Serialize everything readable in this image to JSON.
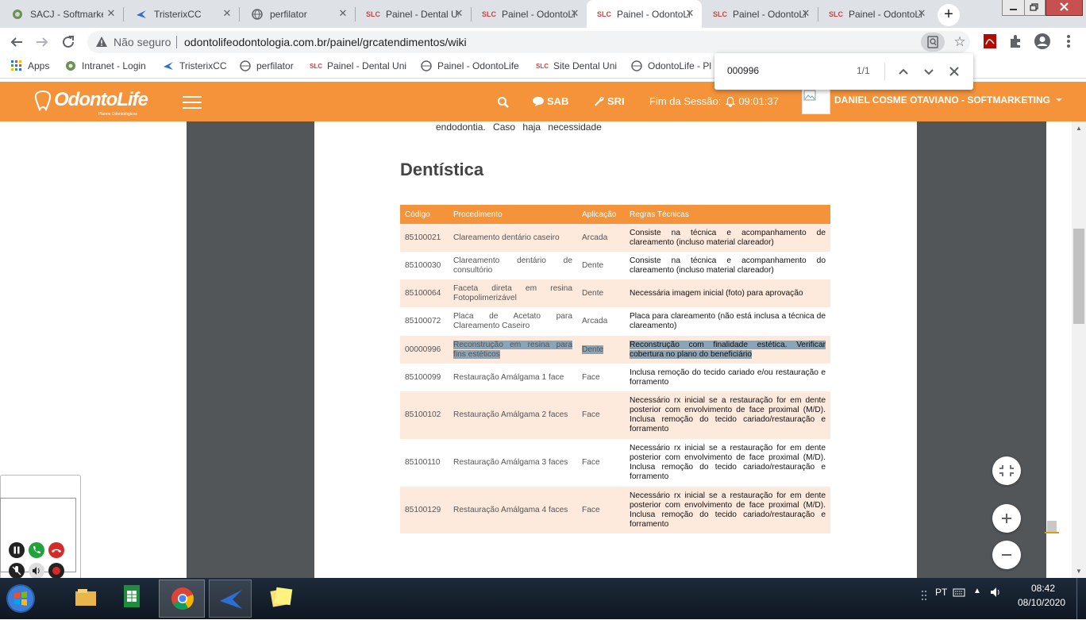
{
  "tabs": [
    {
      "label": "SACJ - Softmarketing",
      "icon": "globe-icon",
      "active": false
    },
    {
      "label": "TristerixCC",
      "icon": "tristerix-icon",
      "active": false
    },
    {
      "label": "perfilator",
      "icon": "globe-icon",
      "active": false
    },
    {
      "label": "Painel - Dental Uni",
      "icon": "slc-icon",
      "active": false
    },
    {
      "label": "Painel - OdontoLife",
      "icon": "slc-icon",
      "active": false
    },
    {
      "label": "Painel - OdontoLife",
      "icon": "slc-icon",
      "active": true
    },
    {
      "label": "Painel - OdontoLife",
      "icon": "slc-icon",
      "active": false
    },
    {
      "label": "Painel - OdontoLife",
      "icon": "slc-icon",
      "active": false
    }
  ],
  "toolbar": {
    "security_label": "Não seguro",
    "url": "odontolifeodontologia.com.br/painel/grcatendimentos/wiki"
  },
  "bookmarks": [
    {
      "label": "Apps",
      "icon": "apps-grid-icon"
    },
    {
      "label": "Intranet - Login",
      "icon": "globe-icon"
    },
    {
      "label": "TristerixCC",
      "icon": "tristerix-icon"
    },
    {
      "label": "perfilator",
      "icon": "globe-icon"
    },
    {
      "label": "Painel - Dental Uni",
      "icon": "slc-icon"
    },
    {
      "label": "Painel - OdontoLife",
      "icon": "globe-icon"
    },
    {
      "label": "Site Dental Uni",
      "icon": "slc-icon"
    },
    {
      "label": "OdontoLife - Pl",
      "icon": "globe-icon"
    }
  ],
  "findbar": {
    "query": "000996",
    "count": "1/1"
  },
  "header": {
    "logo": "OdontoLife",
    "logo_tagline": "Planos Odontológicos",
    "sab_label": "SAB",
    "sri_label": "SRI",
    "session_label": "Fim da Sessão:",
    "session_time": "09:01:37",
    "user_name": "DANIEL COSME OTAVIANO - SOFTMARKETING"
  },
  "document": {
    "top_cut_text": "endodontia. Caso haja necessidade",
    "section_title": "Dentística",
    "columns": [
      "Código",
      "Procedimento",
      "Aplicação",
      "Regras Técnicas"
    ],
    "rows": [
      {
        "codigo": "85100021",
        "procedimento": "Clareamento dentário caseiro",
        "aplicacao": "Arcada",
        "regras": "Consiste na técnica e acompanhamento de clareamento (incluso material clareador)"
      },
      {
        "codigo": "85100030",
        "procedimento": "Clareamento dentário de consultório",
        "aplicacao": "Dente",
        "regras": "Consiste na técnica e acompanhamento do clareamento (incluso material clareador)"
      },
      {
        "codigo": "85100064",
        "procedimento": "Faceta direta em resina Fotopolimerizável",
        "aplicacao": "Dente",
        "regras": "Necessária imagem inicial (foto) para aprovação"
      },
      {
        "codigo": "85100072",
        "procedimento": "Placa de Acetato para Clareamento Caseiro",
        "aplicacao": "Arcada",
        "regras": "Placa para clareamento (não está inclusa a técnica de clareamento)"
      },
      {
        "codigo": "00000996",
        "procedimento": "Reconstrução em resina para fins estéticos",
        "aplicacao": "Dente",
        "regras": "Reconstrução com finalidade estética. Verificar cobertura no plano do beneficiário",
        "highlight": true
      },
      {
        "codigo": "85100099",
        "procedimento": "Restauração Amálgama 1 face",
        "aplicacao": "Face",
        "regras": "Inclusa remoção do tecido cariado e/ou restauração e forramento"
      },
      {
        "codigo": "85100102",
        "procedimento": "Restauração Amálgama 2 faces",
        "aplicacao": "Face",
        "regras": "Necessário rx inicial se a restauração for em dente posterior com envolvimento de face proximal (M/D). Inclusa remoção do tecido cariado/restauração e forramento"
      },
      {
        "codigo": "85100110",
        "procedimento": "Restauração Amálgama 3 faces",
        "aplicacao": "Face",
        "regras": "Necessário rx inicial se a restauração for em dente posterior com envolvimento de face proximal (M/D). Inclusa remoção do tecido cariado/restauração e forramento"
      },
      {
        "codigo": "85100129",
        "procedimento": "Restauração Amálgama 4 faces",
        "aplicacao": "Face",
        "regras": "Necessário rx inicial se a restauração for em dente posterior com envolvimento de face proximal (M/D). Inclusa remoção do tecido cariado/restauração e forramento"
      }
    ]
  },
  "taskbar": {
    "language": "PT",
    "time": "08:42",
    "date": "08/10/2020"
  },
  "colors": {
    "brand_orange": "#f4933a",
    "row_alt": "#fdeadc",
    "highlight": "#8aa4b8",
    "viewer_bg": "#525659"
  }
}
